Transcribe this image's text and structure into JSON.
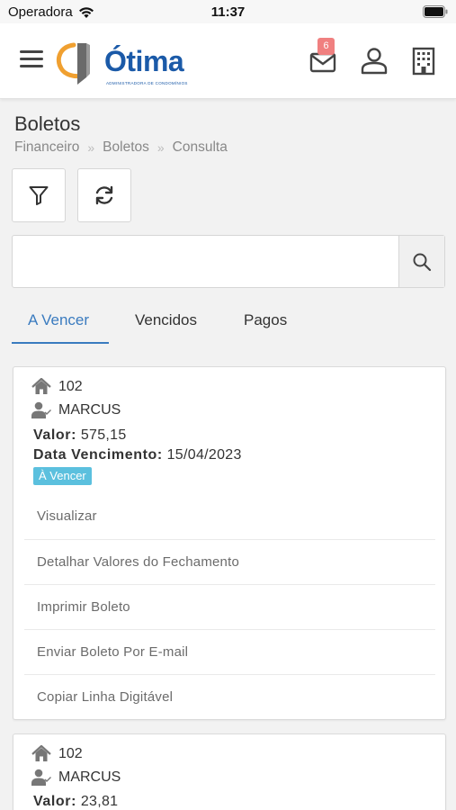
{
  "status_bar": {
    "carrier": "Operadora",
    "time": "11:37"
  },
  "header": {
    "logo_text": "Ótima",
    "logo_subtitle": "ADMINISTRADORA DE CONDOMÍNIOS",
    "mail_badge": "6"
  },
  "page": {
    "title": "Boletos",
    "breadcrumb": [
      "Financeiro",
      "Boletos",
      "Consulta"
    ]
  },
  "search": {
    "value": "",
    "placeholder": ""
  },
  "tabs": [
    {
      "label": "A Vencer",
      "active": true
    },
    {
      "label": "Vencidos",
      "active": false
    },
    {
      "label": "Pagos",
      "active": false
    }
  ],
  "boletos": [
    {
      "unit": "102",
      "owner": "MARCUS",
      "valor_label": "Valor:",
      "valor": "575,15",
      "vencimento_label": "Data Vencimento:",
      "vencimento": "15/04/2023",
      "status": "À Vencer",
      "actions": [
        "Visualizar",
        "Detalhar Valores do Fechamento",
        "Imprimir Boleto",
        "Enviar Boleto Por E-mail",
        "Copiar Linha Digitável"
      ]
    },
    {
      "unit": "102",
      "owner": "MARCUS",
      "valor_label": "Valor:",
      "valor": "23,81"
    }
  ],
  "colors": {
    "accent": "#3a7bbf",
    "badge": "#5bc0de",
    "mail_badge": "#f08080",
    "logo_blue": "#1b5aa8",
    "logo_orange": "#f0a030"
  }
}
